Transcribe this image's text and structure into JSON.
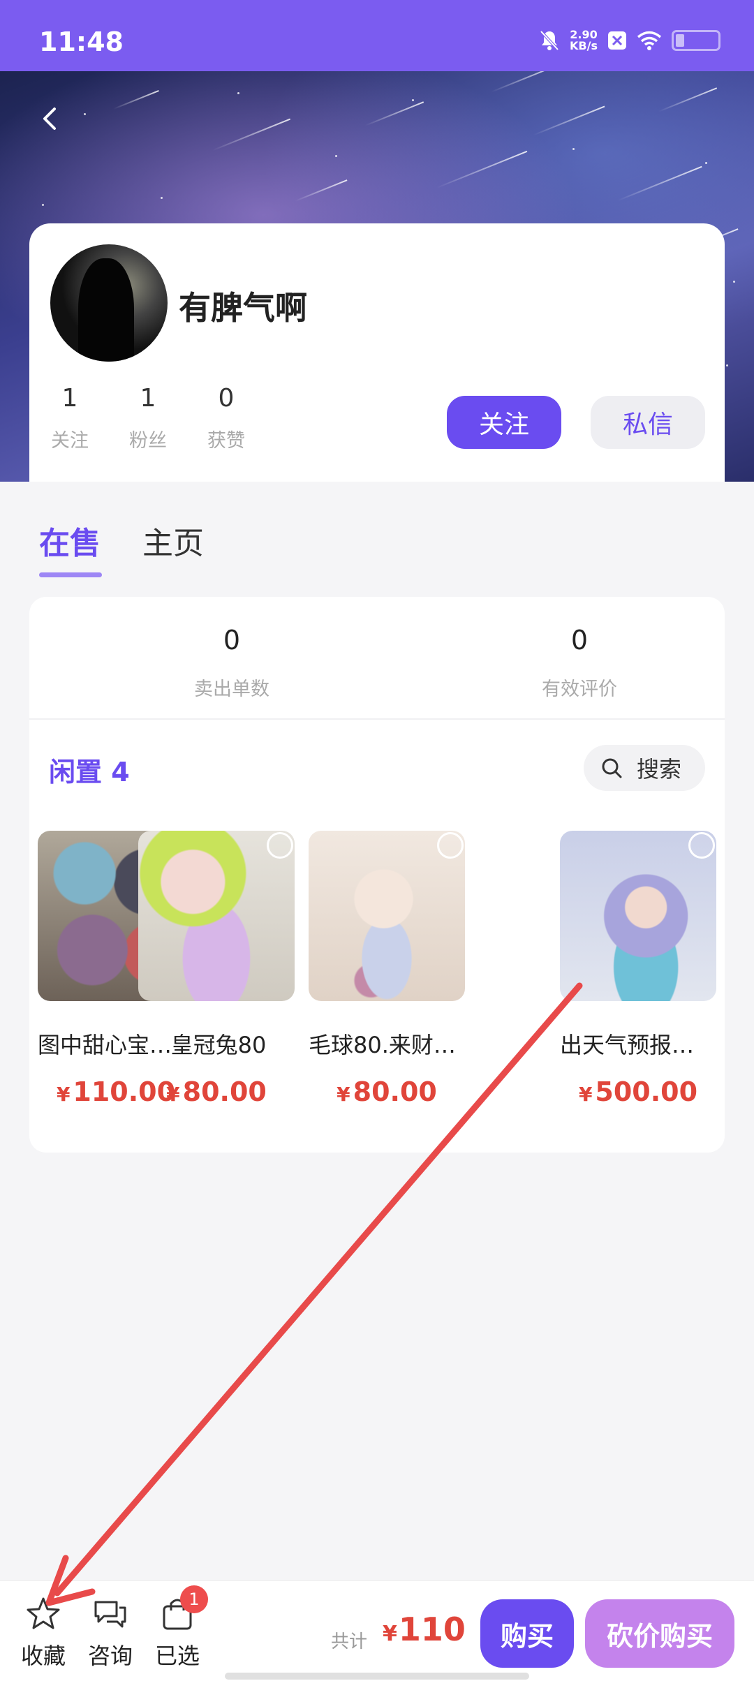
{
  "status_bar": {
    "time": "11:48",
    "net_speed": "2.90",
    "net_unit": "KB/s",
    "icons": [
      "bell-off-icon",
      "x-app-icon",
      "wifi-icon",
      "battery-icon"
    ]
  },
  "header": {
    "back_icon": "chevron-left-icon"
  },
  "profile": {
    "username": "有脾气啊",
    "stats": [
      {
        "num": "1",
        "label": "关注"
      },
      {
        "num": "1",
        "label": "粉丝"
      },
      {
        "num": "0",
        "label": "获赞"
      }
    ],
    "follow_label": "关注",
    "message_label": "私信"
  },
  "tabs": [
    {
      "label": "在售",
      "active": true
    },
    {
      "label": "主页",
      "active": false
    }
  ],
  "metrics": [
    {
      "num": "0",
      "label": "卖出单数"
    },
    {
      "num": "0",
      "label": "有效评价"
    }
  ],
  "section": {
    "title": "闲置 4",
    "search_label": "搜索"
  },
  "products": [
    {
      "name": "图中甜心宝…",
      "yen": "¥",
      "price": "110.00",
      "selected": true
    },
    {
      "name": "皇冠兔80",
      "yen": "¥",
      "price": "80.00",
      "selected": false
    },
    {
      "name": "毛球80.来财…",
      "yen": "¥",
      "price": "80.00",
      "selected": false
    },
    {
      "name": "出天气预报…",
      "yen": "¥",
      "price": "500.00",
      "selected": false
    }
  ],
  "bottom_bar": {
    "favorite_label": "收藏",
    "consult_label": "咨询",
    "selected_label": "已选",
    "selected_badge": "1",
    "total_label": "共计",
    "total_yen": "¥",
    "total_value": "110",
    "buy_label": "购买",
    "bargain_label": "砍价购买"
  },
  "colors": {
    "accent": "#6a4cf0",
    "status_bar": "#7b5cf0",
    "price": "#e0453a",
    "bargain": "#c483ec",
    "annotation_arrow": "#e84a4a"
  }
}
